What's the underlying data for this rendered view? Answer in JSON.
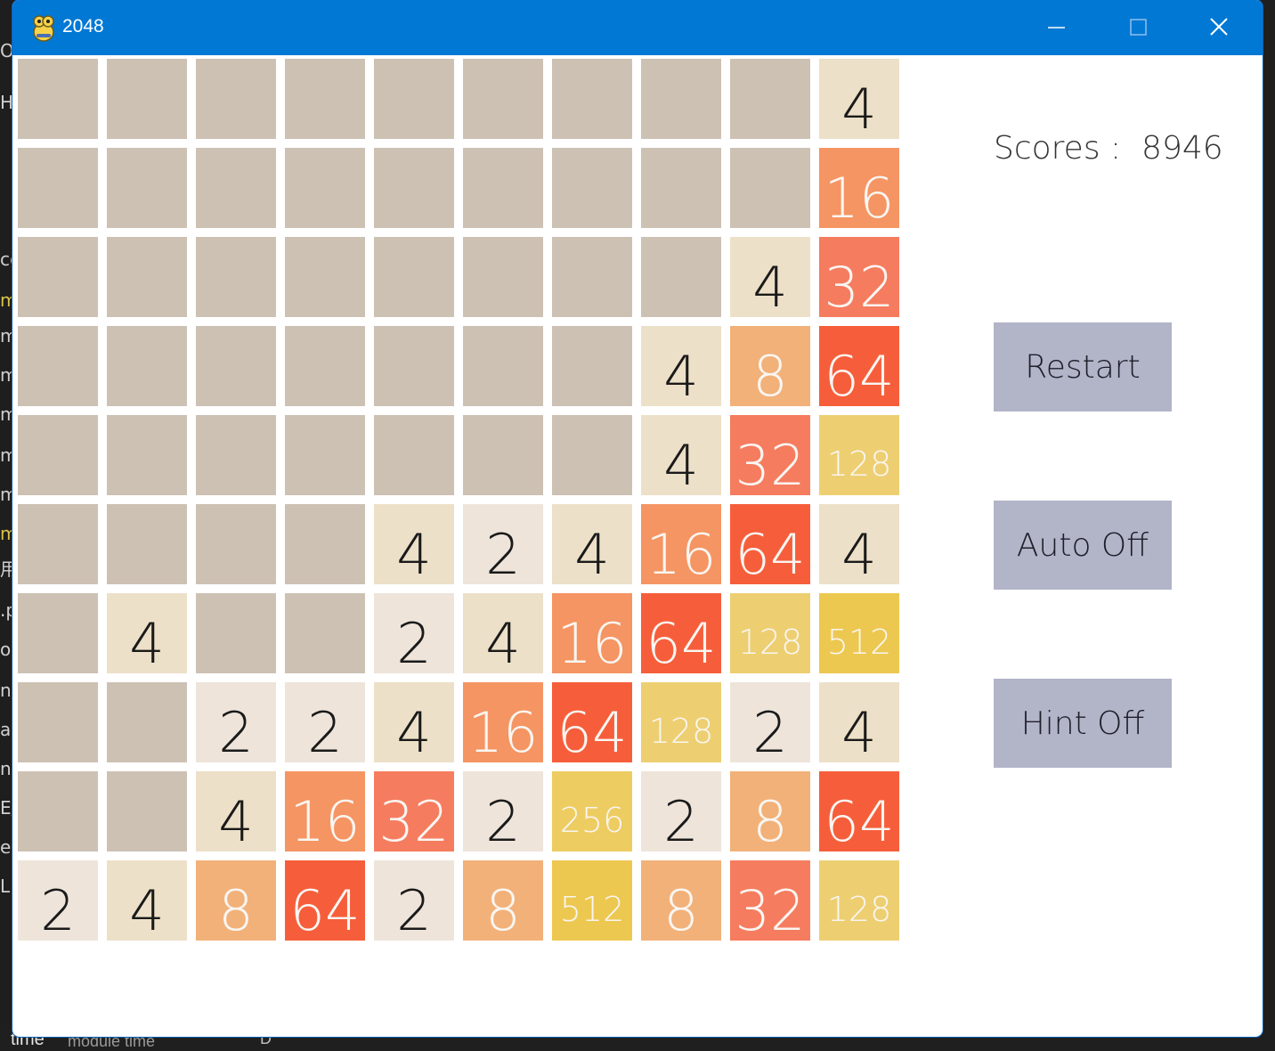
{
  "window": {
    "title": "2048",
    "controls": [
      "minimize-icon",
      "maximize-icon",
      "close-icon"
    ],
    "colors": {
      "titlebar": "#0078d4",
      "background": "#ffffff"
    }
  },
  "background_app": {
    "left_fragments": [
      "O",
      "H",
      "cc",
      "m",
      "m",
      "m",
      "m",
      "m",
      "m",
      "m",
      "用",
      ".p",
      "or",
      "nv",
      "ar",
      "na",
      "E/",
      "ec",
      "LI"
    ],
    "bottom_text": [
      "time",
      "module time",
      "D"
    ]
  },
  "game": {
    "score_label": "Scores :",
    "score": "8946",
    "buttons": {
      "restart": "Restart",
      "auto": "Auto Off",
      "hint": "Hint Off"
    },
    "grid": [
      [
        0,
        0,
        0,
        0,
        0,
        0,
        0,
        0,
        0,
        4
      ],
      [
        0,
        0,
        0,
        0,
        0,
        0,
        0,
        0,
        0,
        16
      ],
      [
        0,
        0,
        0,
        0,
        0,
        0,
        0,
        0,
        4,
        32
      ],
      [
        0,
        0,
        0,
        0,
        0,
        0,
        0,
        4,
        8,
        64
      ],
      [
        0,
        0,
        0,
        0,
        0,
        0,
        0,
        4,
        32,
        128
      ],
      [
        0,
        0,
        0,
        0,
        4,
        2,
        4,
        16,
        64,
        4
      ],
      [
        0,
        4,
        0,
        0,
        2,
        4,
        16,
        64,
        128,
        512
      ],
      [
        0,
        0,
        2,
        2,
        4,
        16,
        64,
        128,
        2,
        4
      ],
      [
        0,
        0,
        4,
        16,
        32,
        2,
        256,
        2,
        8,
        64
      ],
      [
        2,
        4,
        8,
        64,
        2,
        8,
        512,
        8,
        32,
        128
      ]
    ],
    "tile_colors": {
      "0": {
        "bg": "#cdc1b4",
        "fg": "#776e65"
      },
      "2": {
        "bg": "#eee4da",
        "fg": "#1a1a1a"
      },
      "4": {
        "bg": "#ede0c8",
        "fg": "#1a1a1a"
      },
      "8": {
        "bg": "#f2b179",
        "fg": "#f9f6f2"
      },
      "16": {
        "bg": "#f59563",
        "fg": "#f9f6f2"
      },
      "32": {
        "bg": "#f67c5f",
        "fg": "#f9f6f2"
      },
      "64": {
        "bg": "#f65e3b",
        "fg": "#f9f6f2"
      },
      "128": {
        "bg": "#edcf72",
        "fg": "#f9f6f2"
      },
      "256": {
        "bg": "#edcc61",
        "fg": "#f9f6f2"
      },
      "512": {
        "bg": "#edc850",
        "fg": "#f9f6f2"
      }
    }
  }
}
